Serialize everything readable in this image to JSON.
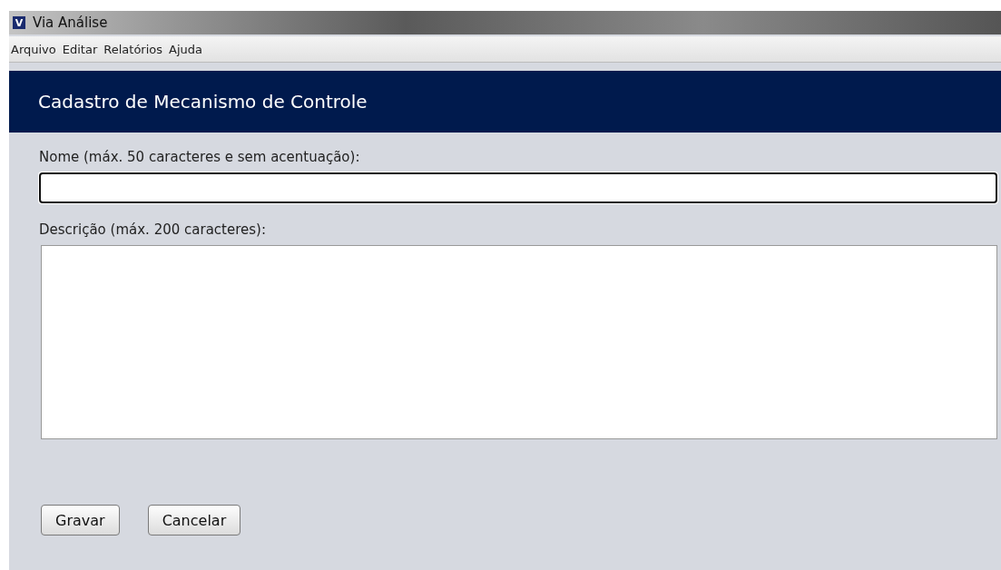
{
  "window": {
    "title": "Via Análise",
    "icon_letter": "V"
  },
  "menu": [
    "Arquivo",
    "Editar",
    "Relatórios",
    "Ajuda"
  ],
  "header": {
    "title": "Cadastro de Mecanismo de Controle"
  },
  "fields": [
    {
      "kind": "line",
      "label": "Nome (máx. 50 caracteres e sem acentuação):",
      "focused": true
    },
    {
      "kind": "area",
      "label": "Descrição (máx. 200 caracteres):",
      "focused": false
    }
  ],
  "buttons": [
    "Gravar",
    "Cancelar"
  ]
}
